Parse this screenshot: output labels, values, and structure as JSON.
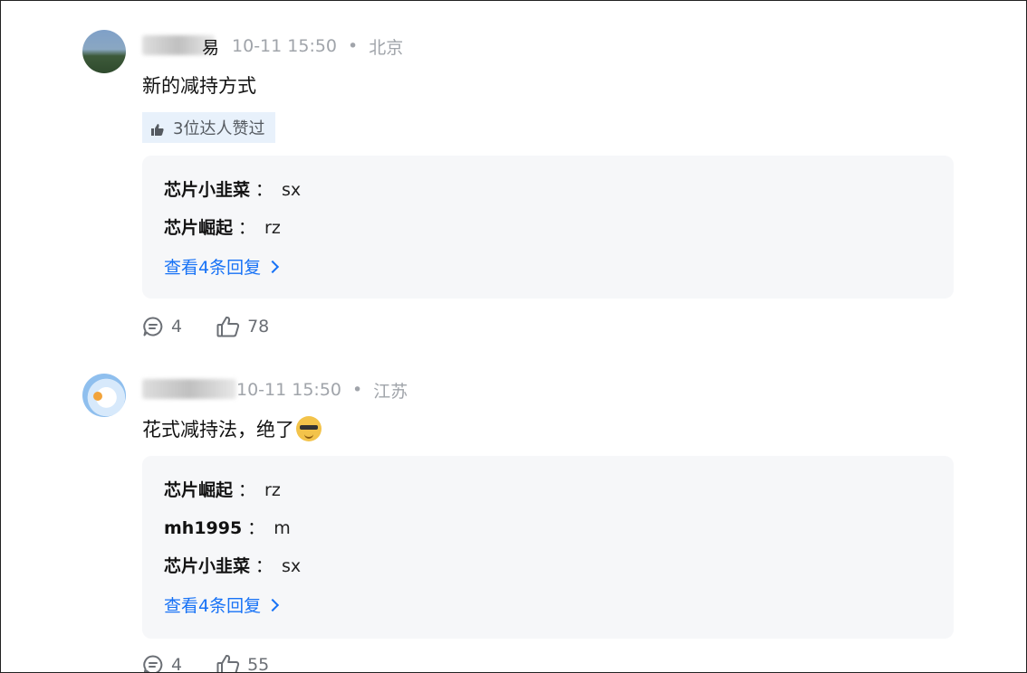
{
  "comments": [
    {
      "author": "易",
      "time": "10-11 15:50",
      "dot": "•",
      "location": "北京",
      "text": "新的减持方式",
      "likes_badge": "3位达人赞过",
      "replies": [
        {
          "name": "芯片小韭菜",
          "sep": "：",
          "text": "sx"
        },
        {
          "name": "芯片崛起",
          "sep": "：",
          "text": "rz"
        }
      ],
      "more_label": "查看4条回复",
      "comment_count": "4",
      "like_count": "78"
    },
    {
      "author": "",
      "time": "10-11 15:50",
      "dot": "•",
      "location": "江苏",
      "text": "花式减持法，绝了",
      "replies": [
        {
          "name": "芯片崛起",
          "sep": "：",
          "text": "rz"
        },
        {
          "name": "mh1995",
          "sep": "：",
          "text": "m"
        },
        {
          "name": "芯片小韭菜",
          "sep": "：",
          "text": "sx"
        }
      ],
      "more_label": "查看4条回复",
      "comment_count": "4",
      "like_count": "55"
    }
  ],
  "colors": {
    "link": "#1772f6",
    "meta": "#a0a4aa",
    "reply_bg": "#f6f7f9",
    "badge_bg": "#e8f1fb"
  },
  "icons": {
    "badge": "thumbs-up-icon",
    "comment": "comment-bubble-icon",
    "like": "thumbs-up-outline-icon"
  }
}
